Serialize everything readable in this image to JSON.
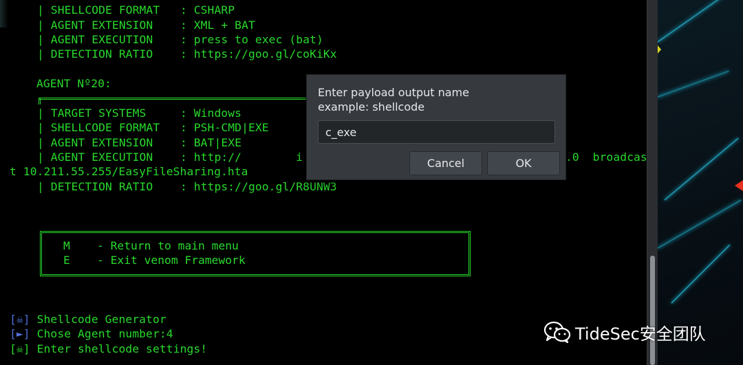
{
  "terminal": {
    "agent19": {
      "shellcode_format": "| SHELLCODE FORMAT   : CSHARP",
      "agent_extension": "| AGENT EXTENSION    : XML + BAT",
      "agent_execution": "| AGENT EXECUTION    : press to exec (bat)",
      "detection_ratio": "| DETECTION RATIO    : https://goo.gl/coKiKx"
    },
    "agent20_header": "AGENT Nº20:",
    "agent20": {
      "target_systems": "| TARGET SYSTEMS     : Windows",
      "shellcode_format": "| SHELLCODE FORMAT   : PSH-CMD|EXE",
      "agent_extension": "| AGENT EXTENSION    : BAT|EXE",
      "agent_execution": "| AGENT EXECUTION    : http://        i",
      "agent_execution_tail": ".0  broadcas",
      "wrapped_line": "t 10.211.55.255/EasyFileSharing.hta",
      "detection_ratio": "| DETECTION RATIO    : https://goo.gl/R8UNW3"
    },
    "menu": {
      "main_menu": "M    - Return to main menu",
      "exit": "E    - Exit venom Framework"
    },
    "status": [
      {
        "bracket": "[☠]",
        "text": " Shellcode Generator"
      },
      {
        "bracket": "[►]",
        "text": " Chose Agent number:4"
      },
      {
        "bracket": "[☠]",
        "text": " Enter shellcode settings!"
      }
    ],
    "text_color": "#29d92d",
    "bracket_color": "#4f6fd8"
  },
  "dialog": {
    "prompt_line1": "Enter payload output name",
    "prompt_line2": "example: shellcode",
    "input_value": "c_exe",
    "cancel_label": "Cancel",
    "ok_label": "OK"
  },
  "watermark": {
    "icon": "wechat-icon",
    "text": "TideSec安全团队"
  }
}
